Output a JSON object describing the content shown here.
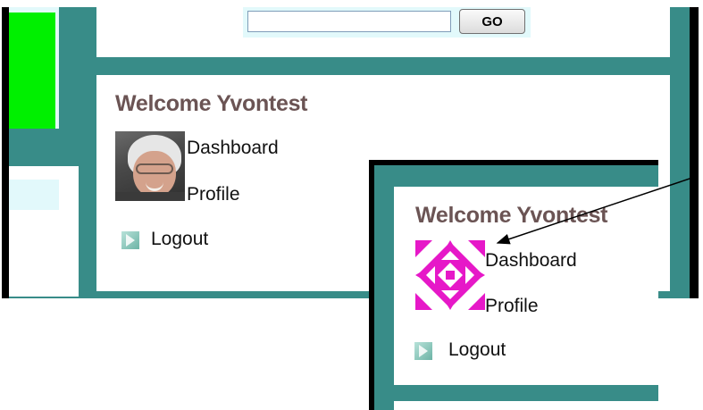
{
  "search": {
    "button_label": "GO",
    "input_value": ""
  },
  "main_panel": {
    "welcome": "Welcome Yvontest",
    "links": {
      "dashboard": "Dashboard",
      "profile": "Profile",
      "logout": "Logout"
    }
  },
  "inset_panel": {
    "welcome": "Welcome Yvontest",
    "links": {
      "dashboard": "Dashboard",
      "profile": "Profile",
      "logout": "Logout"
    }
  },
  "colors": {
    "teal_border": "#388c88",
    "pale_cyan": "#e2f9fb",
    "green_block": "#00f000",
    "welcome_text": "#6b5454",
    "quilt_magenta": "#e618c8"
  },
  "icons": [
    "bullet-arrow-icon",
    "avatar-photo",
    "quilt-avatar-icon",
    "annotation-arrow-icon"
  ]
}
